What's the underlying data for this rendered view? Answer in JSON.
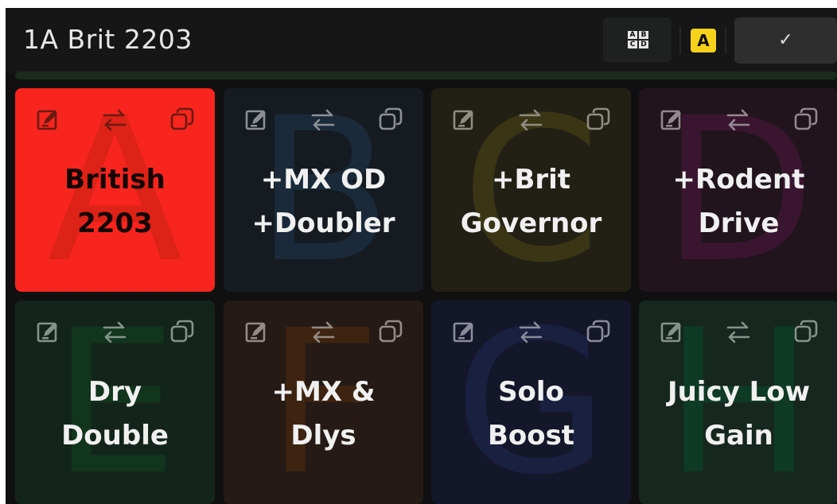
{
  "header": {
    "title": "1A Brit 2203",
    "grid_button_letters": [
      "A",
      "B",
      "C",
      "D"
    ],
    "active_letter": "A",
    "confirm_label": "✓"
  },
  "colors": {
    "active_tile": "#f7251e",
    "badge": "#f7d21b"
  },
  "presets": [
    {
      "letter": "A",
      "name": "British\n2203",
      "active": true,
      "bg": "#f7251e",
      "big_color": "#dd2217",
      "text_color": "#140404",
      "icon_color": "#6b1a12"
    },
    {
      "letter": "B",
      "name": "+MX OD\n+Doubler",
      "active": false,
      "bg": "#151b21",
      "big_color": "#1a2a3a",
      "text_color": "#f0f0f0",
      "icon_color": "#8c9096"
    },
    {
      "letter": "C",
      "name": "+Brit\nGovernor",
      "active": false,
      "bg": "#221f14",
      "big_color": "#3a3515",
      "text_color": "#f0f0f0",
      "icon_color": "#8f8d80"
    },
    {
      "letter": "D",
      "name": "+Rodent\nDrive",
      "active": false,
      "bg": "#21141c",
      "big_color": "#3a1530",
      "text_color": "#f0f0f0",
      "icon_color": "#948890"
    },
    {
      "letter": "E",
      "name": "Dry\nDouble",
      "active": false,
      "bg": "#13251a",
      "big_color": "#12351e",
      "text_color": "#f0f0f0",
      "icon_color": "#85938a"
    },
    {
      "letter": "F",
      "name": "+MX &\nDlys",
      "active": false,
      "bg": "#251a15",
      "big_color": "#3e2410",
      "text_color": "#f0f0f0",
      "icon_color": "#948b87"
    },
    {
      "letter": "G",
      "name": "Solo\nBoost",
      "active": false,
      "bg": "#14172a",
      "big_color": "#1a2040",
      "text_color": "#f0f0f0",
      "icon_color": "#8a8c99"
    },
    {
      "letter": "H",
      "name": "Juicy Low\nGain",
      "active": false,
      "bg": "#15271f",
      "big_color": "#0f3a25",
      "text_color": "#f0f0f0",
      "icon_color": "#869389"
    }
  ]
}
